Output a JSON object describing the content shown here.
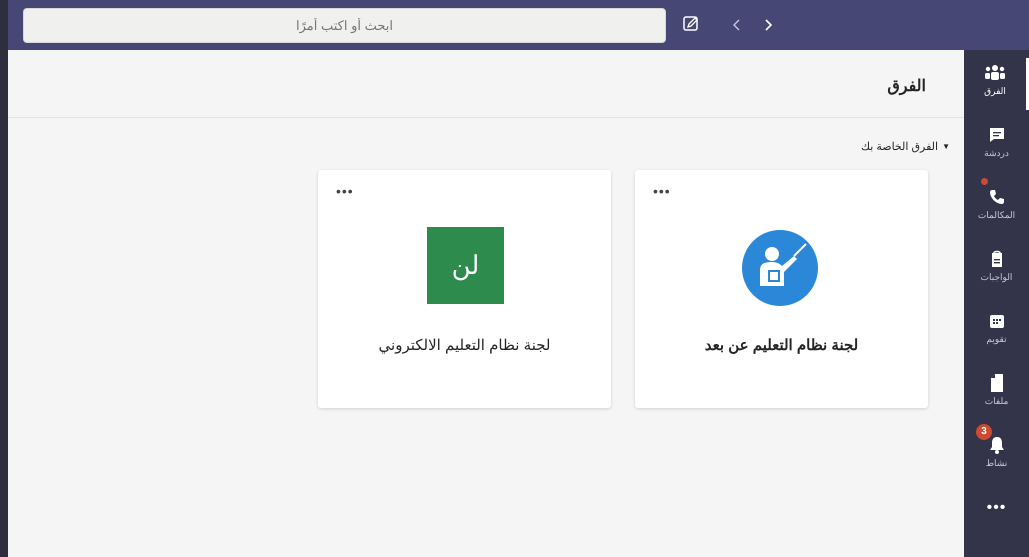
{
  "search": {
    "placeholder": "ابحث أو اكتب أمرًا"
  },
  "rail": {
    "items": [
      {
        "label": "الفرق",
        "icon": "teams-icon"
      },
      {
        "label": "دردشة",
        "icon": "chat-icon"
      },
      {
        "label": "المكالمات",
        "icon": "phone-icon"
      },
      {
        "label": "الواجبات",
        "icon": "assignments-icon"
      },
      {
        "label": "تقويم",
        "icon": "calendar-icon"
      },
      {
        "label": "ملفات",
        "icon": "files-icon"
      },
      {
        "label": "نشاط",
        "icon": "bell-icon",
        "badge": "3"
      }
    ],
    "more": "•••"
  },
  "header": {
    "title": "الفرق"
  },
  "section": {
    "label": "الفرق الخاصة بك"
  },
  "teams": [
    {
      "name": "لجنة نظام التعليم عن بعد",
      "more": "•••",
      "avatar_type": "teacher-icon",
      "avatar_color": "#2b88d8"
    },
    {
      "name": "لجنة نظام التعليم الالكتروني",
      "more": "•••",
      "avatar_initials": "لن",
      "avatar_color": "#2d8c4d"
    }
  ],
  "colors": {
    "topbar": "#464775",
    "rail": "#33344a",
    "badge": "#cc4a31"
  }
}
